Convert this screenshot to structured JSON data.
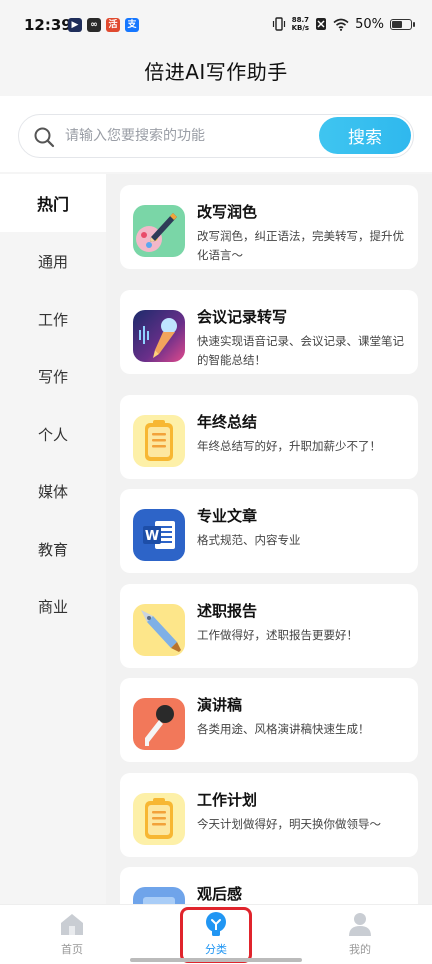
{
  "status_bar": {
    "time": "12:39",
    "net_speed_value": "88.7",
    "net_speed_unit": "KB/s",
    "battery": "50%",
    "battery_level": 0.5,
    "app_icons": [
      {
        "name": "media-app-icon",
        "glyph": "▶",
        "color": "#1f2d5a"
      },
      {
        "name": "link-app-icon",
        "glyph": "∞",
        "color": "#2a2a2a"
      },
      {
        "name": "huodong-app-icon",
        "glyph": "活",
        "color": "#e04a2f"
      },
      {
        "name": "alipay-app-icon",
        "glyph": "支",
        "color": "#1677ff"
      }
    ]
  },
  "header": {
    "title": "倍进AI写作助手"
  },
  "search": {
    "placeholder": "请输入您要搜索的功能",
    "value": "",
    "button_label": "搜索"
  },
  "sidebar": {
    "items": [
      {
        "label": "热门",
        "active": true
      },
      {
        "label": "通用",
        "active": false
      },
      {
        "label": "工作",
        "active": false
      },
      {
        "label": "写作",
        "active": false
      },
      {
        "label": "个人",
        "active": false
      },
      {
        "label": "媒体",
        "active": false
      },
      {
        "label": "教育",
        "active": false
      },
      {
        "label": "商业",
        "active": false
      }
    ]
  },
  "cards": [
    {
      "title": "改写润色",
      "desc": "改写润色，纠正语法，完美转写，提升优化语言～",
      "icon": "pen-palette-icon"
    },
    {
      "title": "会议记录转写",
      "desc": "快速实现语音记录、会议记录、课堂笔记的智能总结！",
      "icon": "microphone-waves-icon"
    },
    {
      "title": "年终总结",
      "desc": "年终总结写的好，升职加薪少不了！",
      "icon": "clipboard-icon"
    },
    {
      "title": "专业文章",
      "desc": "格式规范、内容专业",
      "icon": "word-document-icon"
    },
    {
      "title": "述职报告",
      "desc": "工作做得好，述职报告更要好！",
      "icon": "fountain-pen-icon"
    },
    {
      "title": "演讲稿",
      "desc": "各类用途、风格演讲稿快速生成！",
      "icon": "microphone-icon"
    },
    {
      "title": "工作计划",
      "desc": "今天计划做得好，明天换你做领导～",
      "icon": "clipboard-icon"
    },
    {
      "title": "观后感",
      "desc": "",
      "icon": "monitor-icon"
    }
  ],
  "bottom_nav": {
    "items": [
      {
        "label": "首页",
        "icon": "home-icon",
        "active": false
      },
      {
        "label": "分类",
        "icon": "lightbulb-icon",
        "active": true
      },
      {
        "label": "我的",
        "icon": "person-icon",
        "active": false
      }
    ]
  },
  "colors": {
    "accent": "#2fb8ee",
    "nav_active": "#2196f3",
    "highlight": "#e0242c"
  }
}
